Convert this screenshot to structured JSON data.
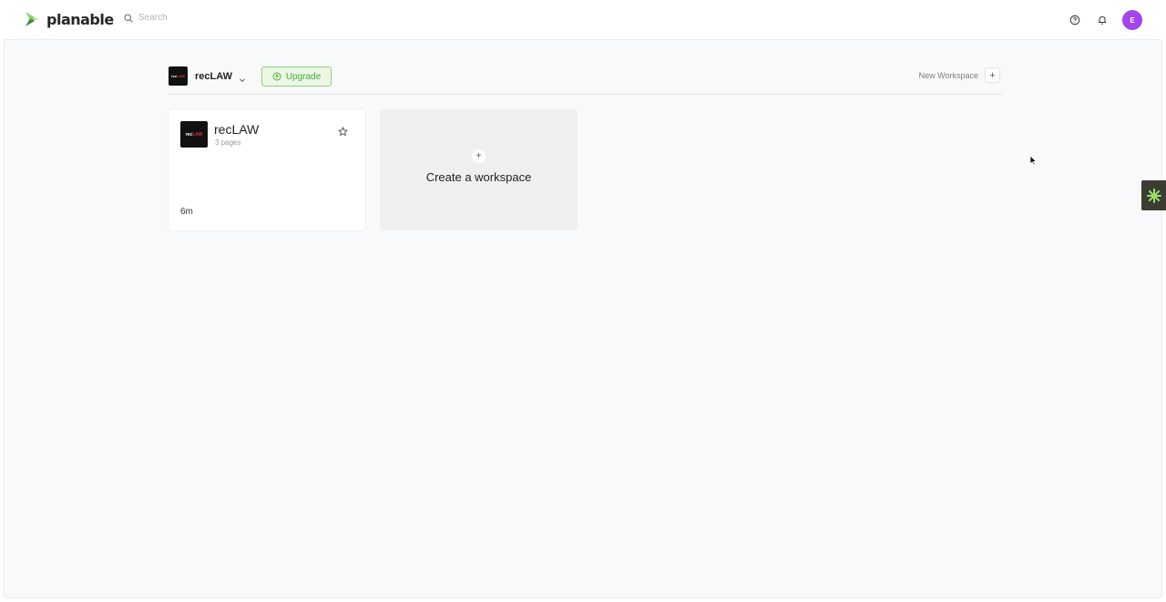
{
  "topbar": {
    "brand": "planable",
    "search_placeholder": "Search",
    "avatar_initial": "E",
    "icons": [
      "help-icon",
      "bell-icon"
    ]
  },
  "workspace_header": {
    "name": "recLAW",
    "logo_text_a": "rec",
    "logo_text_b": "LAW",
    "upgrade_label": "Upgrade",
    "new_workspace_label": "New Workspace",
    "add_label": "+"
  },
  "cards": [
    {
      "title": "recLAW",
      "subtitle": "3 pages",
      "time": "6m"
    }
  ],
  "create_card": {
    "plus": "+",
    "label": "Create a workspace"
  },
  "colors": {
    "accent_purple": "#a245ee",
    "upgrade_green": "#4fa73b",
    "upgrade_bg": "#eaf8e4",
    "brand_red": "#e0282f",
    "widget_bg": "#3b3d33",
    "widget_star": "#9be36a"
  }
}
